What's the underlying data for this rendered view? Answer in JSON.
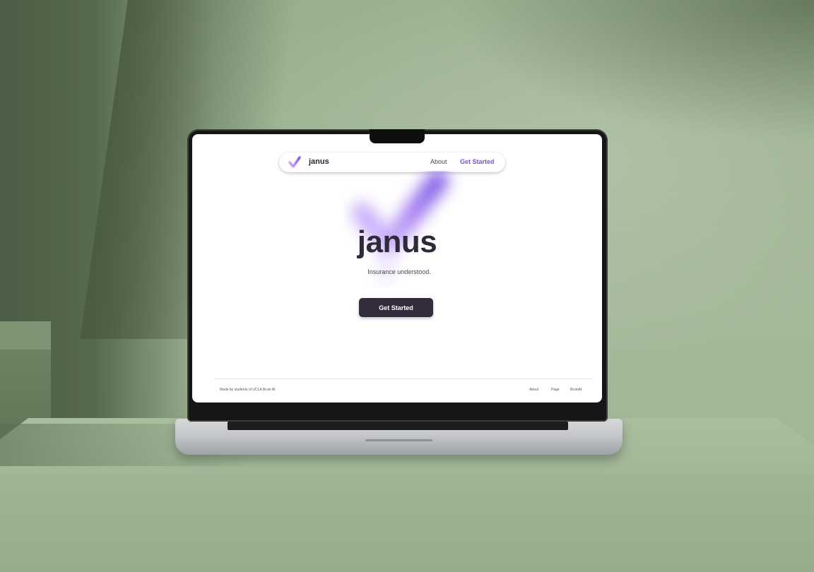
{
  "navbar": {
    "brand": "janus",
    "about_label": "About",
    "get_started_label": "Get Started"
  },
  "hero": {
    "title": "janus",
    "subtitle": "Insurance understood.",
    "cta_label": "Get Started"
  },
  "footer": {
    "credit": "Made by students of UCLA Bruin AI.",
    "links": [
      "About",
      "Page",
      "BruinAI"
    ]
  },
  "colors": {
    "accent": "#7a4fe6",
    "button_bg": "#332c3c",
    "title_text": "#2f2a3a",
    "background_wall": "#9fb496"
  },
  "icons": {
    "logo": "checkmark-blur-icon"
  }
}
